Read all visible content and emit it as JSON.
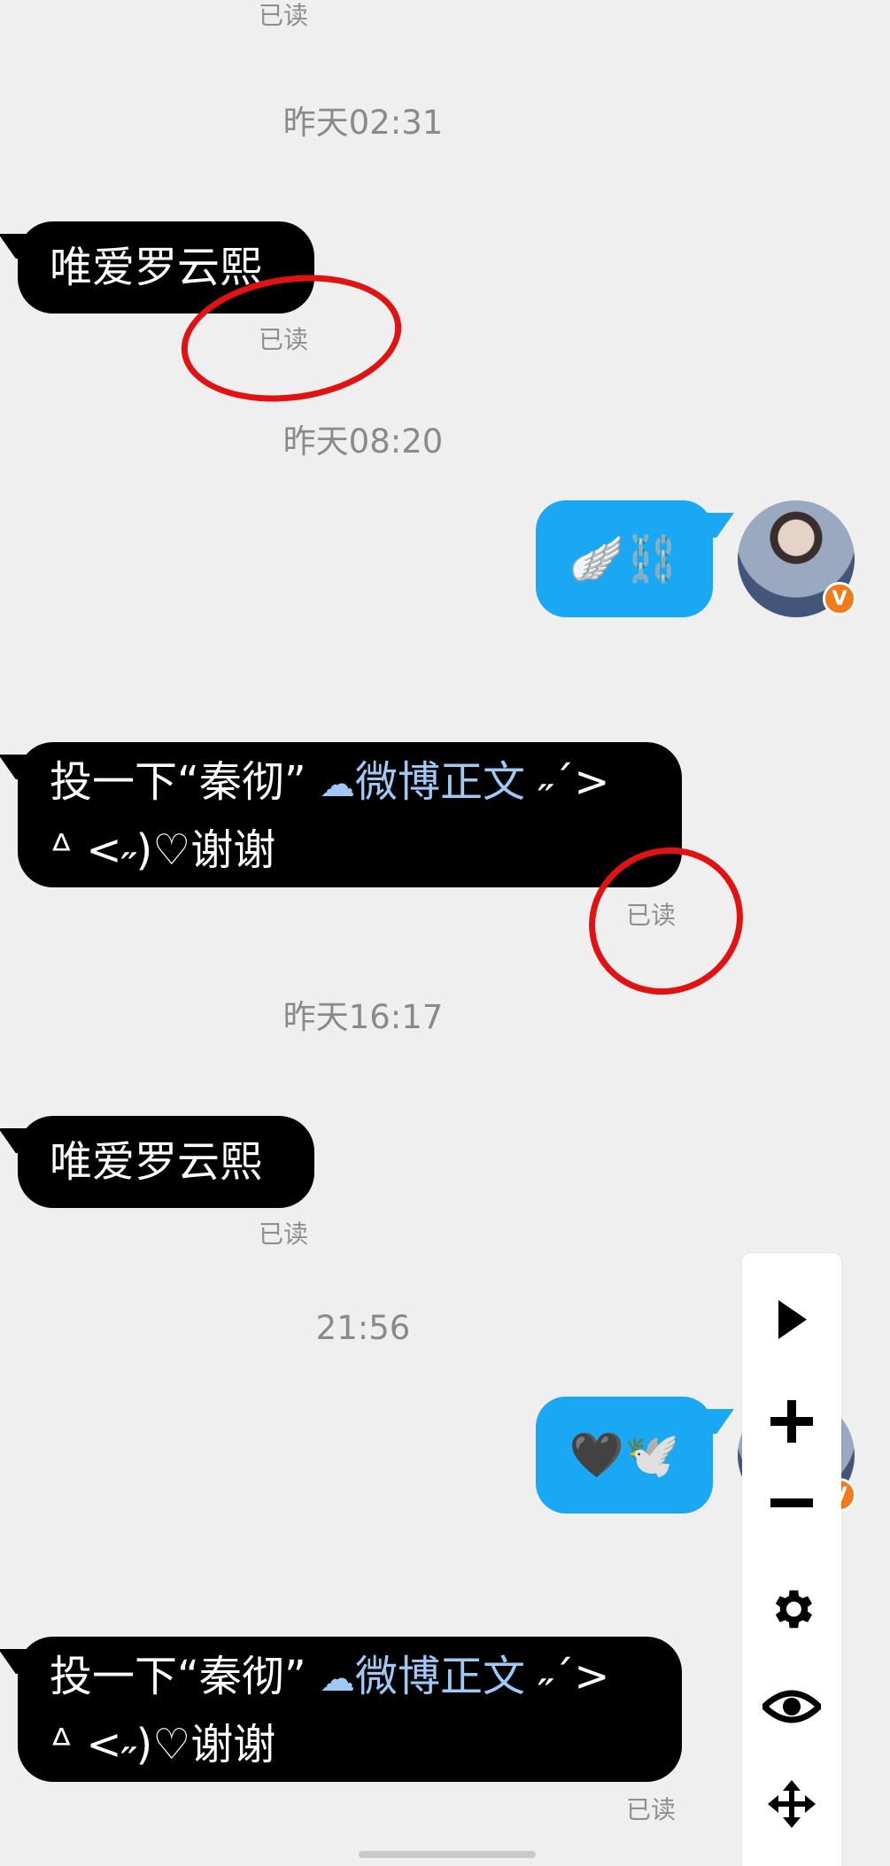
{
  "messages": {
    "read_label": "已读",
    "t1": "昨天02:31",
    "m1": "唯爱罗云熙",
    "t2": "昨天08:20",
    "t3": "昨天16:17",
    "m3": "唯爱罗云熙",
    "t4": "21:56",
    "m2_line1_prefix": "投一下“秦彻”",
    "m2_link": "微博正文",
    "m2_line1_suffix": " ˶ˊ>",
    "m2_line2": "ᐞ <˶)♡谢谢",
    "m4_line1_prefix": "投一下“秦彻”",
    "m4_link": "微博正文",
    "m4_line1_suffix": " ˶ˊ>",
    "m4_line2": "ᐞ <˶)♡谢谢",
    "out1_emoji": "🪽⛓️",
    "out2_emoji": "🖤🕊️"
  },
  "avatar_badge": "V",
  "colors": {
    "incoming_bubble": "#000000",
    "outgoing_bubble": "#1aa8f4",
    "link": "#9fc8f4",
    "annotation": "#e01212",
    "badge": "#f17a1a"
  },
  "toolbar_icons": [
    "play-icon",
    "zoom-in-icon",
    "zoom-out-icon",
    "gear-icon",
    "eye-icon",
    "move-icon"
  ]
}
